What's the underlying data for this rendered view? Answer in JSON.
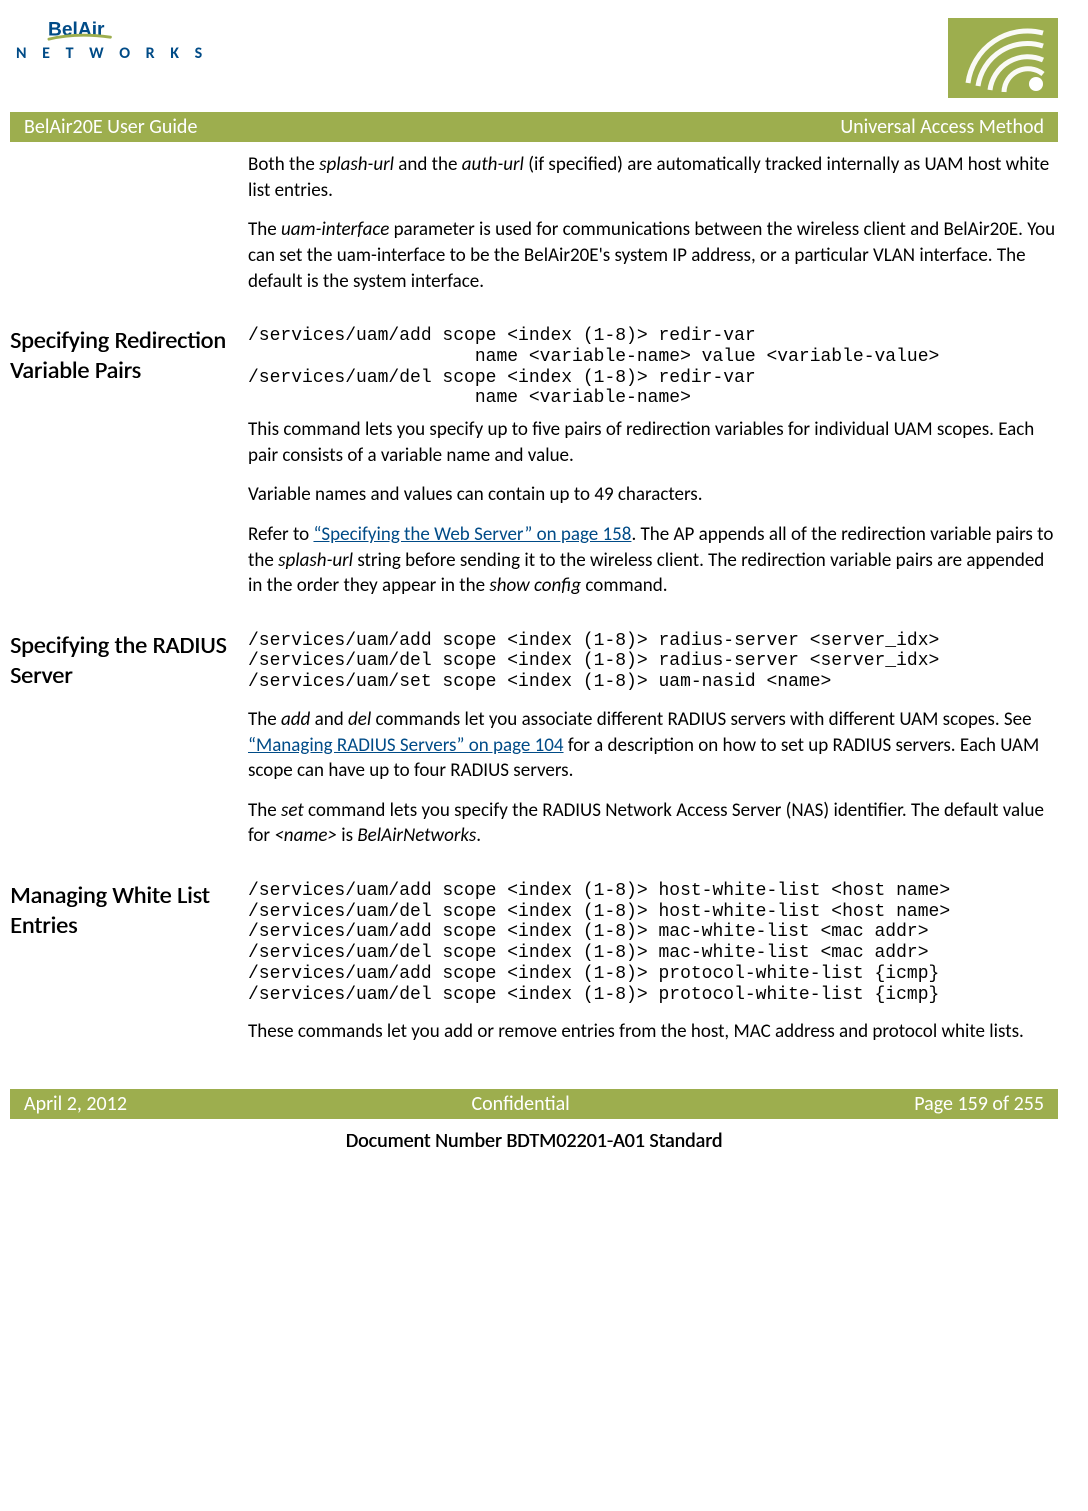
{
  "header": {
    "brand_top": "BelAir",
    "brand_bottom": "N E T W O R K S"
  },
  "titlebar": {
    "left": "BelAir20E User Guide",
    "right": "Universal Access Method"
  },
  "intro": {
    "p1_a": "Both the ",
    "p1_i1": "splash-url",
    "p1_b": " and the ",
    "p1_i2": "auth-url",
    "p1_c": " (if specified) are automatically tracked internally as UAM host white list entries.",
    "p2_a": "The ",
    "p2_i1": "uam-interface",
    "p2_b": " parameter is used for communications between the wireless client and BelAir20E. You can set the uam-interface to be the BelAir20E's system IP address, or a particular VLAN interface. The default is the system interface."
  },
  "sec1": {
    "heading": "Specifying Redirection Variable Pairs",
    "code": "/services/uam/add scope <index (1-8)> redir-var\n                     name <variable-name> value <variable-value>\n/services/uam/del scope <index (1-8)> redir-var\n                     name <variable-name>",
    "p1": "This command lets you specify up to five pairs of redirection variables for individual UAM scopes. Each pair consists of a variable name and value.",
    "p2": "Variable names and values can contain up to 49 characters.",
    "p3_a": "Refer to ",
    "p3_link": "“Specifying the Web Server” on page 158",
    "p3_b": ". The AP appends all of the redirection variable pairs to the ",
    "p3_i1": "splash-url",
    "p3_c": " string before sending it to the wireless client. The redirection variable pairs are appended in the order they appear in the ",
    "p3_i2": "show config",
    "p3_d": " command."
  },
  "sec2": {
    "heading": "Specifying the RADIUS Server",
    "code": "/services/uam/add scope <index (1-8)> radius-server <server_idx>\n/services/uam/del scope <index (1-8)> radius-server <server_idx>\n/services/uam/set scope <index (1-8)> uam-nasid <name>",
    "p1_a": "The ",
    "p1_i1": "add",
    "p1_b": " and ",
    "p1_i2": "del",
    "p1_c": " commands let you associate different RADIUS servers with different UAM scopes. See ",
    "p1_link": "“Managing RADIUS Servers” on page 104",
    "p1_d": " for a description on how to set up RADIUS servers. Each UAM scope can have up to four RADIUS servers.",
    "p2_a": "The ",
    "p2_i1": "set",
    "p2_b": " command lets you specify the RADIUS Network Access Server (NAS) identifier. The default value for ",
    "p2_i2": "<name>",
    "p2_c": " is ",
    "p2_i3": "BelAirNetworks",
    "p2_d": "."
  },
  "sec3": {
    "heading": "Managing White List Entries",
    "code": "/services/uam/add scope <index (1-8)> host-white-list <host name>\n/services/uam/del scope <index (1-8)> host-white-list <host name>\n/services/uam/add scope <index (1-8)> mac-white-list <mac addr>\n/services/uam/del scope <index (1-8)> mac-white-list <mac addr>\n/services/uam/add scope <index (1-8)> protocol-white-list {icmp}\n/services/uam/del scope <index (1-8)> protocol-white-list {icmp}",
    "p1": "These commands let you add or remove entries from the host, MAC address and protocol white lists."
  },
  "footer": {
    "left": "April 2, 2012",
    "center": "Confidential",
    "right": "Page 159 of 255",
    "docnum": "Document Number BDTM02201-A01 Standard"
  }
}
